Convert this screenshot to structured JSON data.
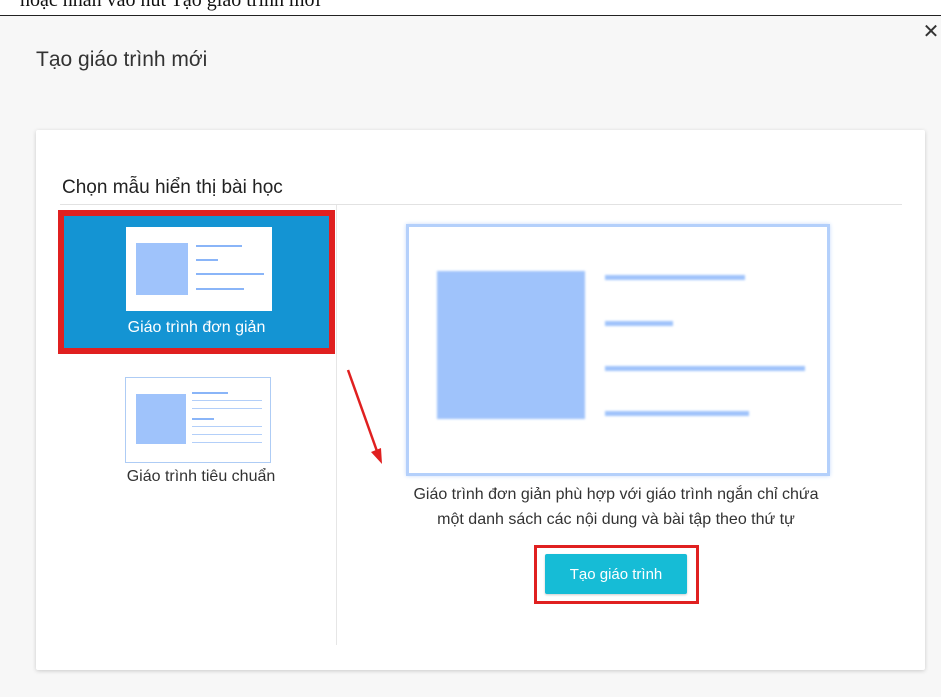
{
  "top_text": "hoặc nhấn vào nút Tạo giáo trình mới",
  "dialog": {
    "title": "Tạo giáo trình mới",
    "close_icon": "✕"
  },
  "section": {
    "title": "Chọn mẫu hiển thị bài học"
  },
  "templates": [
    {
      "label": "Giáo trình đơn giản",
      "selected": true
    },
    {
      "label": "Giáo trình tiêu chuẩn",
      "selected": false
    }
  ],
  "preview": {
    "description_line1": "Giáo trình đơn giản phù hợp với giáo trình ngắn chỉ chứa",
    "description_line2": "một danh sách các nội dung và bài tập theo thứ tự"
  },
  "actions": {
    "create_label": "Tạo giáo trình"
  },
  "colors": {
    "accent": "#1494d3",
    "button": "#16bcd6",
    "highlight": "#e02020",
    "thumb_fill": "#9fc3fb",
    "thumb_line": "#8ab5f8"
  }
}
